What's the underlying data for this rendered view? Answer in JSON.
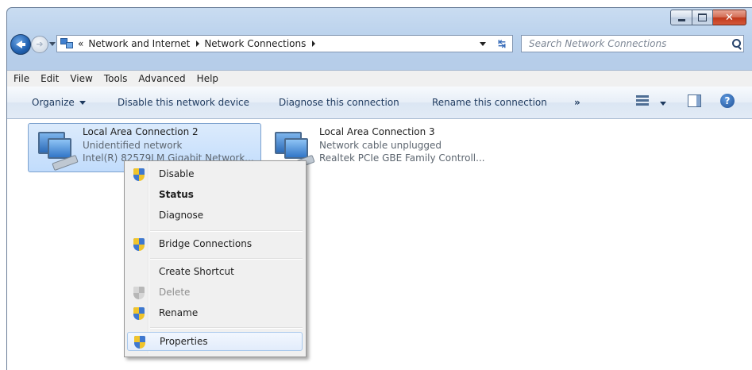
{
  "address": {
    "overflow": "«",
    "crumbs": [
      "Network and Internet",
      "Network Connections"
    ]
  },
  "search": {
    "placeholder": "Search Network Connections"
  },
  "menu": [
    "File",
    "Edit",
    "View",
    "Tools",
    "Advanced",
    "Help"
  ],
  "commands": {
    "organize": "Organize",
    "disable": "Disable this network device",
    "diagnose": "Diagnose this connection",
    "rename": "Rename this connection",
    "more": "»"
  },
  "connections": [
    {
      "name": "Local Area Connection 2",
      "status": "Unidentified network",
      "device": "Intel(R) 82579LM Gigabit Network...",
      "selected": true
    },
    {
      "name": "Local Area Connection 3",
      "status": "Network cable unplugged",
      "device": "Realtek PCIe GBE Family Controll...",
      "selected": false
    }
  ],
  "context_menu": {
    "disable": "Disable",
    "status": "Status",
    "diagnose": "Diagnose",
    "bridge": "Bridge Connections",
    "shortcut": "Create Shortcut",
    "delete": "Delete",
    "rename": "Rename",
    "properties": "Properties"
  },
  "icons": {
    "back": "back-arrow-icon",
    "forward": "forward-arrow-icon",
    "refresh": "refresh-icon",
    "search": "search-icon",
    "help": "help-icon",
    "shield": "uac-shield-icon"
  },
  "colors": {
    "selection": "#c1dcfc",
    "close_button": "#c0391b"
  }
}
